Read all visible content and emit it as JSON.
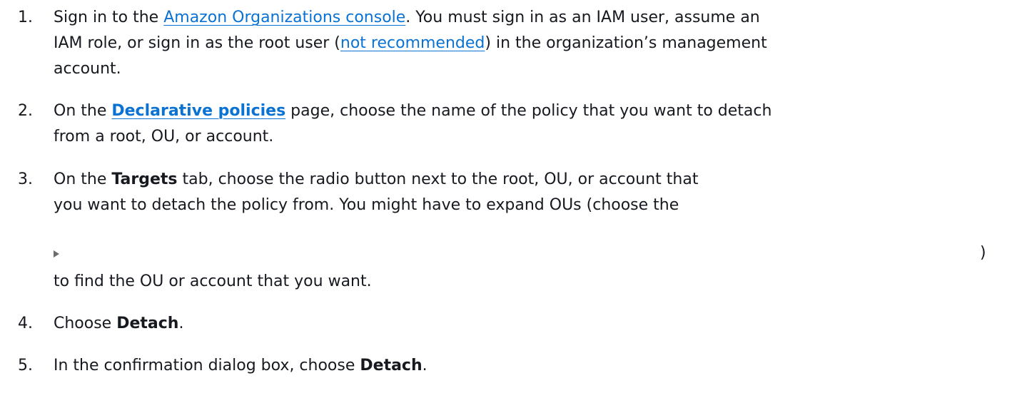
{
  "steps": [
    {
      "number": "1.",
      "line1": {
        "pre": "Sign in to the ",
        "link": "Amazon Organizations console",
        "post": ". You must sign in as an IAM user, assume an"
      },
      "line2": {
        "pre": "IAM role, or sign in as the root user (",
        "link": "not recommended",
        "post": ") in the organization’s management"
      },
      "line3": "account."
    },
    {
      "number": "2.",
      "line1": {
        "pre": "On the ",
        "link": "Declarative policies",
        "post": " page, choose the name of the policy that you want to detach"
      },
      "line2": "from a root, OU, or account."
    },
    {
      "number": "3.",
      "line1": {
        "pre": "On the ",
        "bold": "Targets",
        "post": " tab, choose the radio button next to the root, OU, or account that"
      },
      "line2": "you want to detach the policy from. You might have to expand OUs (choose the",
      "icon": "expand-triangle-icon",
      "close_paren": ")",
      "line4": "to find the OU or account that you want."
    },
    {
      "number": "4.",
      "pre": "Choose ",
      "bold": "Detach",
      "post": "."
    },
    {
      "number": "5.",
      "pre": "In the confirmation dialog box, choose ",
      "bold": "Detach",
      "post": "."
    }
  ],
  "colors": {
    "text": "#16191f",
    "link": "#0972d3",
    "icon": "#6b6b6b"
  }
}
